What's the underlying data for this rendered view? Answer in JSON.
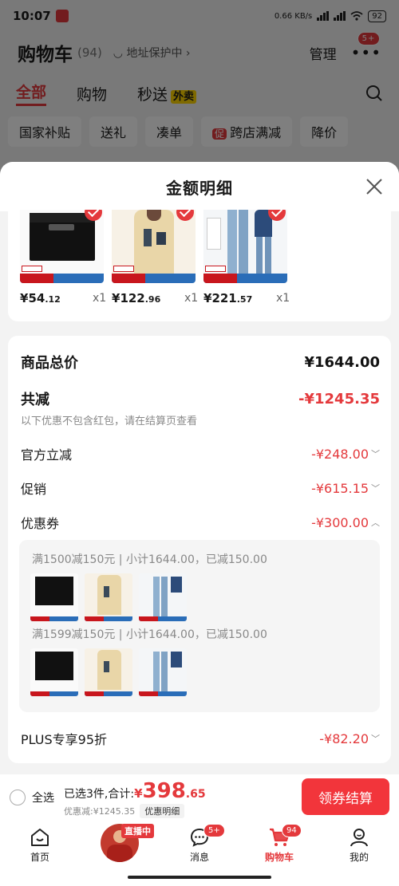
{
  "status_bar": {
    "time": "10:07",
    "speed": "0.66 KB/s",
    "battery": "92"
  },
  "cart_header": {
    "title": "购物车",
    "count": "(94)",
    "address_protect": "地址保护中",
    "manage": "管理",
    "more_badge": "5+"
  },
  "cart_tabs": [
    {
      "label": "全部",
      "active": true
    },
    {
      "label": "购物"
    },
    {
      "label": "秒送"
    }
  ],
  "waimai_tag": "外卖",
  "chips": [
    "国家补贴",
    "送礼",
    "凑单",
    "跨店满减",
    "降价"
  ],
  "chip_promo_icon": "促",
  "sheet": {
    "title": "金额明细"
  },
  "products": [
    {
      "yen": "¥",
      "price_int": "54",
      "price_dec": ".12",
      "qty": "x1"
    },
    {
      "yen": "¥",
      "price_int": "122",
      "price_dec": ".96",
      "qty": "x1"
    },
    {
      "yen": "¥",
      "price_int": "221",
      "price_dec": ".57",
      "qty": "x1"
    }
  ],
  "summary": {
    "total_label": "商品总价",
    "total_value": "¥1644.00",
    "reduce_label": "共减",
    "reduce_value": "-¥1245.35",
    "note": "以下优惠不包含红包，请在结算页查看",
    "official_label": "官方立减",
    "official_value": "-¥248.00",
    "promo_label": "促销",
    "promo_value": "-¥615.15",
    "coupon_label": "优惠券",
    "coupon_value": "-¥300.00",
    "coupon_lines": [
      "满1500减150元 | 小计1644.00，已减150.00",
      "满1599减150元 | 小计1644.00，已减150.00"
    ],
    "plus_label": "PLUS专享95折",
    "plus_value": "-¥82.20"
  },
  "bottom_bar": {
    "select_all": "全选",
    "selected_text": "已选3件,合计:",
    "yen": "¥",
    "sum_int": "398",
    "sum_dec": ".65",
    "discount_text": "优惠减:¥1245.35",
    "detail_btn": "优惠明细",
    "checkout": "领券结算"
  },
  "nav": {
    "home": "首页",
    "live": "直播中",
    "messages": "消息",
    "messages_badge": "5+",
    "cart": "购物车",
    "cart_badge": "94",
    "mine": "我的"
  },
  "colors": {
    "accent": "#e4393c",
    "checkout_button": "#f2353b"
  }
}
